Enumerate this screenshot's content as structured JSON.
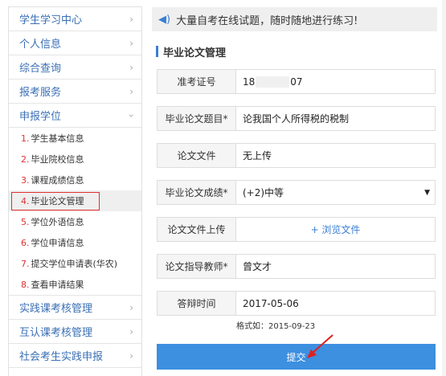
{
  "sidebar": {
    "items_top": [
      {
        "label": "学生学习中心"
      },
      {
        "label": "个人信息"
      },
      {
        "label": "综合查询"
      },
      {
        "label": "报考服务"
      },
      {
        "label": "申报学位"
      }
    ],
    "sub_items": [
      {
        "num": "1.",
        "label": "学生基本信息"
      },
      {
        "num": "2.",
        "label": "毕业院校信息"
      },
      {
        "num": "3.",
        "label": "课程成绩信息"
      },
      {
        "num": "4.",
        "label": "毕业论文管理"
      },
      {
        "num": "5.",
        "label": "学位外语信息"
      },
      {
        "num": "6.",
        "label": "学位申请信息"
      },
      {
        "num": "7.",
        "label": "提交学位申请表(华农)"
      },
      {
        "num": "8.",
        "label": "查看申请结果"
      }
    ],
    "items_bottom": [
      {
        "label": "实践课考核管理"
      },
      {
        "label": "互认课考核管理"
      },
      {
        "label": "社会考生实践申报"
      }
    ]
  },
  "notice": {
    "text": "大量自考在线试题，随时随地进行练习!"
  },
  "section": {
    "title": "毕业论文管理"
  },
  "form": {
    "exam_no_label": "准考证号",
    "exam_no_prefix": "18",
    "exam_no_suffix": "07",
    "topic_label": "毕业论文题目*",
    "topic_value": "论我国个人所得税的税制",
    "file_label": "论文文件",
    "file_value": "无上传",
    "grade_label": "毕业论文成绩*",
    "grade_value": "(+2)中等",
    "upload_label": "论文文件上传",
    "upload_value": "+ 浏览文件",
    "advisor_label": "论文指导教师*",
    "advisor_value": "曾文才",
    "defense_label": "答辩时间",
    "defense_value": "2017-05-06",
    "date_hint": "格式如：2015-09-23",
    "submit_label": "提交"
  }
}
